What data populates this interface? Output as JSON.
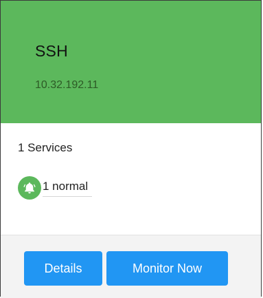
{
  "host": {
    "name": "SSH",
    "ip": "10.32.192.11",
    "status_color": "#5cb85c"
  },
  "services": {
    "count_label": "1 Services",
    "status_icon": "bell-icon",
    "status_label": "1 normal"
  },
  "actions": {
    "details_label": "Details",
    "monitor_label": "Monitor Now",
    "button_color": "#2196f3"
  }
}
